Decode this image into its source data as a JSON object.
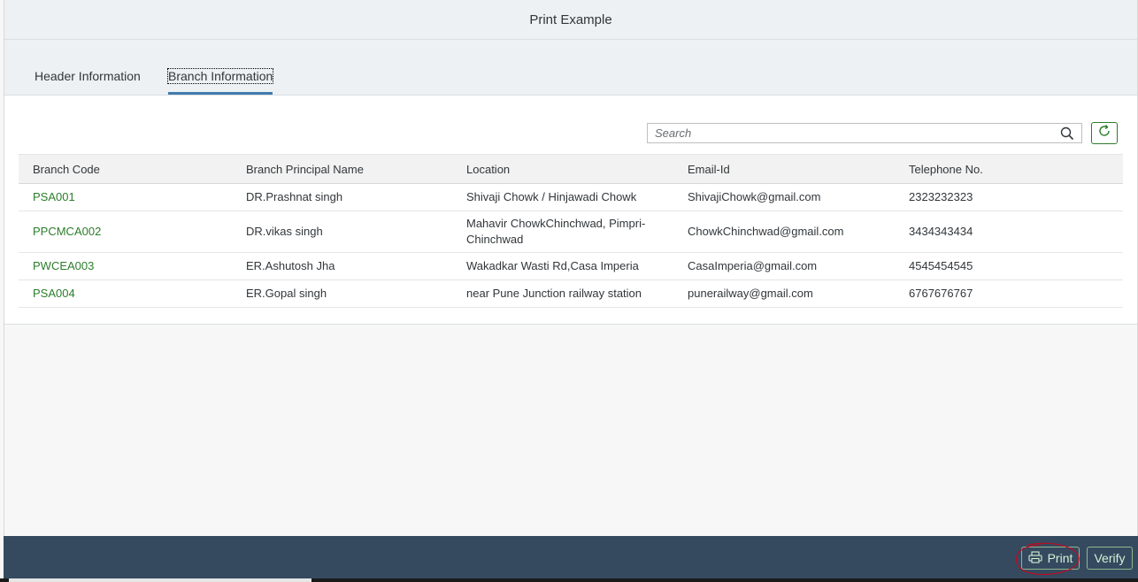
{
  "window": {
    "title": "Print Example"
  },
  "tabs": [
    {
      "label": "Header Information",
      "selected": false
    },
    {
      "label": "Branch Information",
      "selected": true
    }
  ],
  "search": {
    "placeholder": "Search",
    "value": ""
  },
  "icons": {
    "search": "search-icon",
    "refresh": "refresh-icon",
    "print": "printer-icon"
  },
  "table": {
    "columns": [
      "Branch Code",
      "Branch Principal Name",
      "Location",
      "Email-Id",
      "Telephone No."
    ],
    "rows": [
      [
        "PSA001",
        "DR.Prashnat singh",
        "Shivaji Chowk / Hinjawadi Chowk",
        "ShivajiChowk@gmail.com",
        "2323232323"
      ],
      [
        "PPCMCA002",
        "DR.vikas singh",
        "Mahavir ChowkChinchwad, Pimpri-Chinchwad",
        "ChowkChinchwad@gmail.com",
        "3434343434"
      ],
      [
        "PWCEA003",
        "ER.Ashutosh Jha",
        "Wakadkar Wasti Rd,Casa Imperia",
        "CasaImperia@gmail.com",
        "4545454545"
      ],
      [
        "PSA004",
        "ER.Gopal singh",
        "near Pune Junction railway station",
        "punerailway@gmail.com",
        "6767676767"
      ]
    ]
  },
  "footer": {
    "print_label": "Print",
    "verify_label": "Verify"
  },
  "colors": {
    "accent_green": "#2b7d2b",
    "footer_bg": "#354a5f",
    "tab_underline": "#427cac",
    "annotation_red": "#d0021b"
  }
}
